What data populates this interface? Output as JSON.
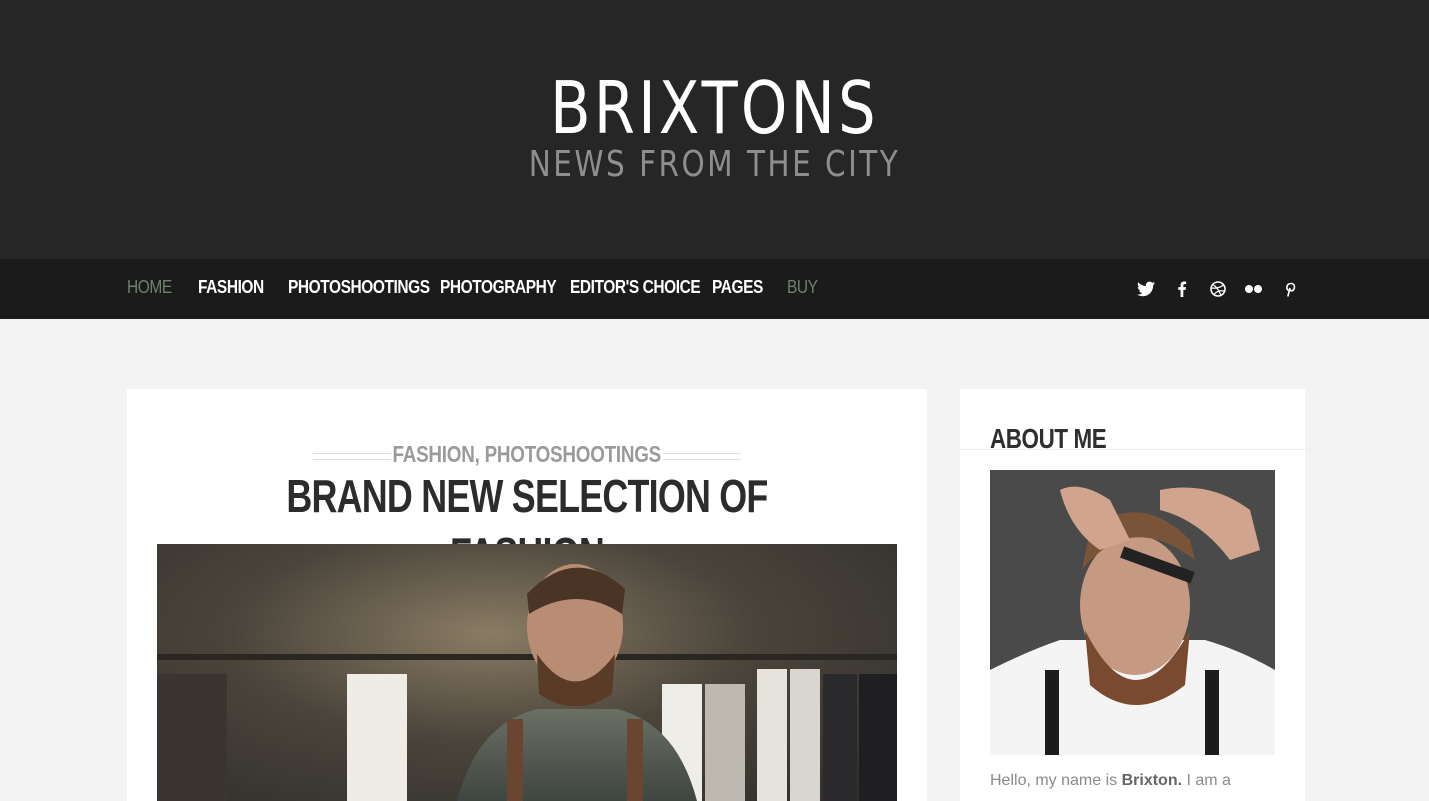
{
  "header": {
    "site_title": "BRIXTONS",
    "tagline": "NEWS FROM THE CITY"
  },
  "nav": {
    "items": [
      {
        "label": "HOME",
        "state": "active"
      },
      {
        "label": "FASHION"
      },
      {
        "label": "PHOTOSHOOTINGS"
      },
      {
        "label": "PHOTOGRAPHY"
      },
      {
        "label": "EDITOR'S CHOICE"
      },
      {
        "label": "PAGES"
      },
      {
        "label": "BUY",
        "state": "accent"
      }
    ],
    "social_icons": [
      "twitter-icon",
      "facebook-icon",
      "dribbble-icon",
      "flickr-icon",
      "pinterest-icon"
    ],
    "active_color": "#6f8270"
  },
  "post": {
    "categories": "FASHION, PHOTOSHOOTINGS",
    "title": "BRAND NEW SELECTION OF FASHION"
  },
  "sidebar": {
    "widget_title": "ABOUT ME",
    "intro_prefix": "Hello, my name is ",
    "intro_name": "Brixton.",
    "intro_suffix": " I am a"
  }
}
